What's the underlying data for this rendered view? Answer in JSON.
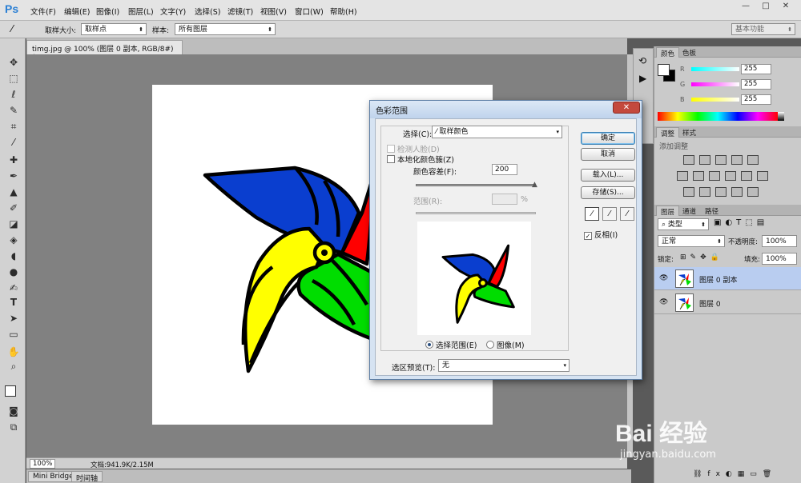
{
  "app": {
    "logo": "Ps"
  },
  "menu": [
    "文件(F)",
    "编辑(E)",
    "图像(I)",
    "图层(L)",
    "文字(Y)",
    "选择(S)",
    "滤镜(T)",
    "视图(V)",
    "窗口(W)",
    "帮助(H)"
  ],
  "window_controls": {
    "minimize": "—",
    "maximize": "□",
    "close": "✕"
  },
  "options": {
    "sample_size_label": "取样大小:",
    "sample_size_value": "取样点",
    "sample_label": "样本:",
    "sample_value": "所有图层",
    "workspace_value": "基本功能"
  },
  "document": {
    "tab_title": "timg.jpg @ 100% (图层 0 副本, RGB/8#) *",
    "tab_close": "×"
  },
  "status": {
    "zoom": "100%",
    "doc_info": "文档:941.9K/2.15M"
  },
  "bottom_tabs": [
    "Mini Bridge",
    "时间轴"
  ],
  "color_panel": {
    "tabs": [
      "颜色",
      "色板"
    ],
    "channels": [
      {
        "label": "R",
        "value": "255"
      },
      {
        "label": "G",
        "value": "255"
      },
      {
        "label": "B",
        "value": "255"
      }
    ]
  },
  "adjust_panel": {
    "tabs": [
      "调整",
      "样式"
    ],
    "title": "添加调整"
  },
  "layers_panel": {
    "tabs": [
      "图层",
      "通道",
      "路径"
    ],
    "kind_label": "类型",
    "blend_mode": "正常",
    "opacity_label": "不透明度:",
    "opacity_value": "100%",
    "lock_label": "锁定:",
    "fill_label": "填充:",
    "fill_value": "100%",
    "layers": [
      {
        "name": "图层 0 副本",
        "selected": true
      },
      {
        "name": "图层 0",
        "selected": false
      }
    ]
  },
  "dialog": {
    "title": "色彩范围",
    "select_label": "选择(C):",
    "select_value": "取样颜色",
    "detect_faces": "检测人脸(D)",
    "localized": "本地化颜色簇(Z)",
    "fuzziness_label": "颜色容差(F):",
    "fuzziness_value": "200",
    "fuzziness": 1.0,
    "range_label": "范围(R):",
    "range_unit": "%",
    "radio_selection": "选择范围(E)",
    "radio_image": "图像(M)",
    "preview_label": "选区预览(T):",
    "preview_value": "无",
    "buttons": {
      "ok": "确定",
      "cancel": "取消",
      "load": "载入(L)...",
      "save": "存储(S)..."
    },
    "invert_label": "反相(I)",
    "invert_checked": true,
    "close": "✕"
  },
  "watermark": {
    "brand": "Bai 经验",
    "url": "jingyan.baidu.com"
  },
  "colors": {
    "red": "#ff0000",
    "yellow": "#ffff00",
    "green": "#00dd00",
    "blue": "#0a3ecf"
  }
}
